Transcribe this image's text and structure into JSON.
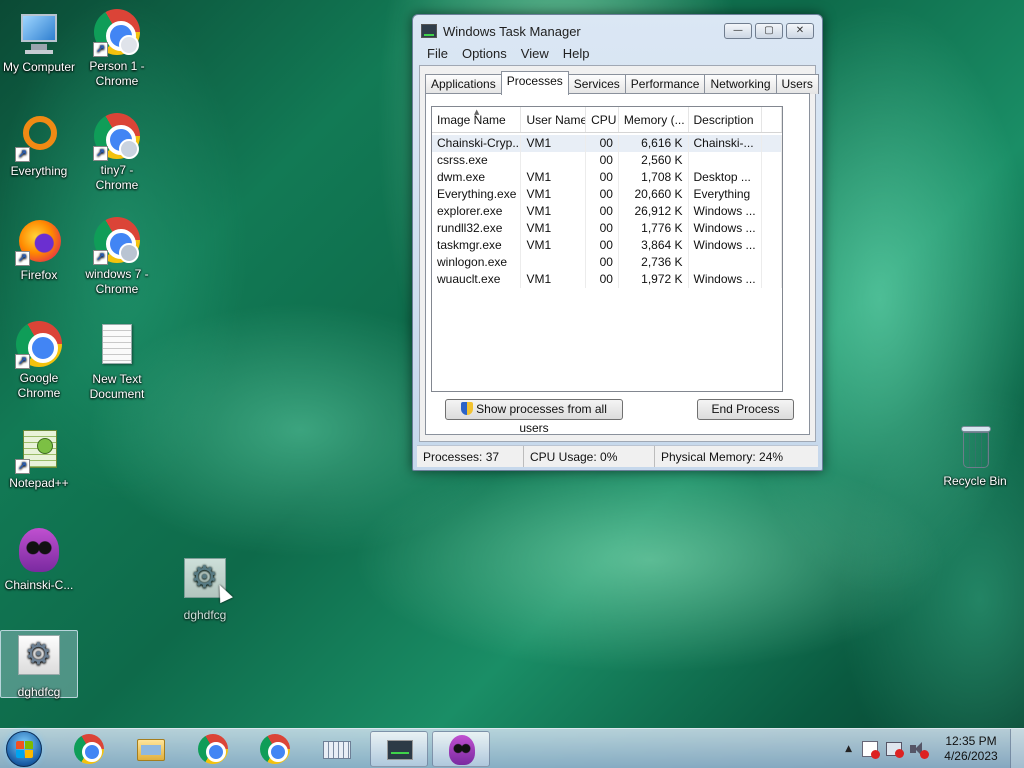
{
  "desktop": {
    "icons": [
      {
        "label": "My Computer",
        "icon": "computer-icon"
      },
      {
        "label": "Person 1 - Chrome",
        "icon": "chrome-icon"
      },
      {
        "label": "Everything",
        "icon": "everything-icon"
      },
      {
        "label": "tiny7 - Chrome",
        "icon": "chrome-icon"
      },
      {
        "label": "Firefox",
        "icon": "firefox-icon"
      },
      {
        "label": "windows 7 - Chrome",
        "icon": "chrome-icon"
      },
      {
        "label": "Google Chrome",
        "icon": "chrome-icon"
      },
      {
        "label": "New Text Document",
        "icon": "text-document-icon"
      },
      {
        "label": "Notepad++",
        "icon": "notepad-plus-plus-icon"
      },
      {
        "label": "Chainski-C...",
        "icon": "skull-icon"
      },
      {
        "label": "dghdfcg",
        "icon": "gear-file-icon"
      },
      {
        "label": "dghdfcg",
        "icon": "gear-file-icon"
      },
      {
        "label": "Recycle Bin",
        "icon": "recycle-bin-icon"
      }
    ]
  },
  "taskmgr": {
    "title": "Windows Task Manager",
    "controls": {
      "minimize": "—",
      "maximize": "▢",
      "close": "✕"
    },
    "menu": [
      "File",
      "Options",
      "View",
      "Help"
    ],
    "tabs": [
      "Applications",
      "Processes",
      "Services",
      "Performance",
      "Networking",
      "Users"
    ],
    "active_tab": "Processes",
    "columns": [
      "Image Name",
      "User Name",
      "CPU",
      "Memory (...",
      "Description"
    ],
    "rows": [
      {
        "image": "Chainski-Cryp...",
        "user": "VM1",
        "cpu": "00",
        "mem": "6,616 K",
        "desc": "Chainski-..."
      },
      {
        "image": "csrss.exe",
        "user": "",
        "cpu": "00",
        "mem": "2,560 K",
        "desc": ""
      },
      {
        "image": "dwm.exe",
        "user": "VM1",
        "cpu": "00",
        "mem": "1,708 K",
        "desc": "Desktop ..."
      },
      {
        "image": "Everything.exe",
        "user": "VM1",
        "cpu": "00",
        "mem": "20,660 K",
        "desc": "Everything"
      },
      {
        "image": "explorer.exe",
        "user": "VM1",
        "cpu": "00",
        "mem": "26,912 K",
        "desc": "Windows ..."
      },
      {
        "image": "rundll32.exe",
        "user": "VM1",
        "cpu": "00",
        "mem": "1,776 K",
        "desc": "Windows ..."
      },
      {
        "image": "taskmgr.exe",
        "user": "VM1",
        "cpu": "00",
        "mem": "3,864 K",
        "desc": "Windows ..."
      },
      {
        "image": "winlogon.exe",
        "user": "",
        "cpu": "00",
        "mem": "2,736 K",
        "desc": ""
      },
      {
        "image": "wuauclt.exe",
        "user": "VM1",
        "cpu": "00",
        "mem": "1,972 K",
        "desc": "Windows ..."
      }
    ],
    "show_all_label": "Show processes from all users",
    "end_process_label": "End Process",
    "status": {
      "processes": "Processes: 37",
      "cpu": "CPU Usage: 0%",
      "memory": "Physical Memory: 24%"
    }
  },
  "taskbar": {
    "clock_time": "12:35 PM",
    "clock_date": "4/26/2023",
    "tray_arrow": "▲"
  }
}
